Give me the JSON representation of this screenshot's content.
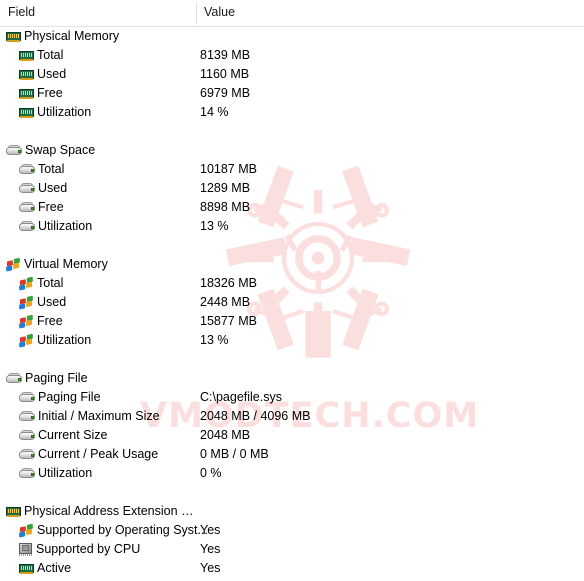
{
  "header": {
    "field_label": "Field",
    "value_label": "Value"
  },
  "watermark": {
    "text": "VMODTECH.COM",
    "color": "#fbdede"
  },
  "rows": [
    {
      "level": 0,
      "group_start": false,
      "icon": "ram-icon",
      "label": "Physical Memory",
      "value": ""
    },
    {
      "level": 1,
      "group_start": false,
      "icon": "ram-icon",
      "label": "Total",
      "value": "8139 MB"
    },
    {
      "level": 1,
      "group_start": false,
      "icon": "ram-icon",
      "label": "Used",
      "value": "1160 MB"
    },
    {
      "level": 1,
      "group_start": false,
      "icon": "ram-icon",
      "label": "Free",
      "value": "6979 MB"
    },
    {
      "level": 1,
      "group_start": false,
      "icon": "ram-icon",
      "label": "Utilization",
      "value": "14 %"
    },
    {
      "level": 0,
      "group_start": true,
      "icon": "hdd-icon",
      "label": "Swap Space",
      "value": ""
    },
    {
      "level": 1,
      "group_start": false,
      "icon": "hdd-icon",
      "label": "Total",
      "value": "10187 MB"
    },
    {
      "level": 1,
      "group_start": false,
      "icon": "hdd-icon",
      "label": "Used",
      "value": "1289 MB"
    },
    {
      "level": 1,
      "group_start": false,
      "icon": "hdd-icon",
      "label": "Free",
      "value": "8898 MB"
    },
    {
      "level": 1,
      "group_start": false,
      "icon": "hdd-icon",
      "label": "Utilization",
      "value": "13 %"
    },
    {
      "level": 0,
      "group_start": true,
      "icon": "windows-icon",
      "label": "Virtual Memory",
      "value": ""
    },
    {
      "level": 1,
      "group_start": false,
      "icon": "windows-icon",
      "label": "Total",
      "value": "18326 MB"
    },
    {
      "level": 1,
      "group_start": false,
      "icon": "windows-icon",
      "label": "Used",
      "value": "2448 MB"
    },
    {
      "level": 1,
      "group_start": false,
      "icon": "windows-icon",
      "label": "Free",
      "value": "15877 MB"
    },
    {
      "level": 1,
      "group_start": false,
      "icon": "windows-icon",
      "label": "Utilization",
      "value": "13 %"
    },
    {
      "level": 0,
      "group_start": true,
      "icon": "hdd-icon",
      "label": "Paging File",
      "value": ""
    },
    {
      "level": 1,
      "group_start": false,
      "icon": "hdd-icon",
      "label": "Paging File",
      "value": "C:\\pagefile.sys"
    },
    {
      "level": 1,
      "group_start": false,
      "icon": "hdd-icon",
      "label": "Initial / Maximum Size",
      "value": "2048 MB / 4096 MB"
    },
    {
      "level": 1,
      "group_start": false,
      "icon": "hdd-icon",
      "label": "Current Size",
      "value": "2048 MB"
    },
    {
      "level": 1,
      "group_start": false,
      "icon": "hdd-icon",
      "label": "Current / Peak Usage",
      "value": "0 MB / 0 MB"
    },
    {
      "level": 1,
      "group_start": false,
      "icon": "hdd-icon",
      "label": "Utilization",
      "value": "0 %"
    },
    {
      "level": 0,
      "group_start": true,
      "icon": "ram-icon",
      "label": "Physical Address Extension (PAE)",
      "value": ""
    },
    {
      "level": 1,
      "group_start": false,
      "icon": "windows-icon",
      "label": "Supported by Operating Syst...",
      "value": "Yes"
    },
    {
      "level": 1,
      "group_start": false,
      "icon": "cpu-icon",
      "label": "Supported by CPU",
      "value": "Yes"
    },
    {
      "level": 1,
      "group_start": false,
      "icon": "ram-icon",
      "label": "Active",
      "value": "Yes"
    }
  ]
}
